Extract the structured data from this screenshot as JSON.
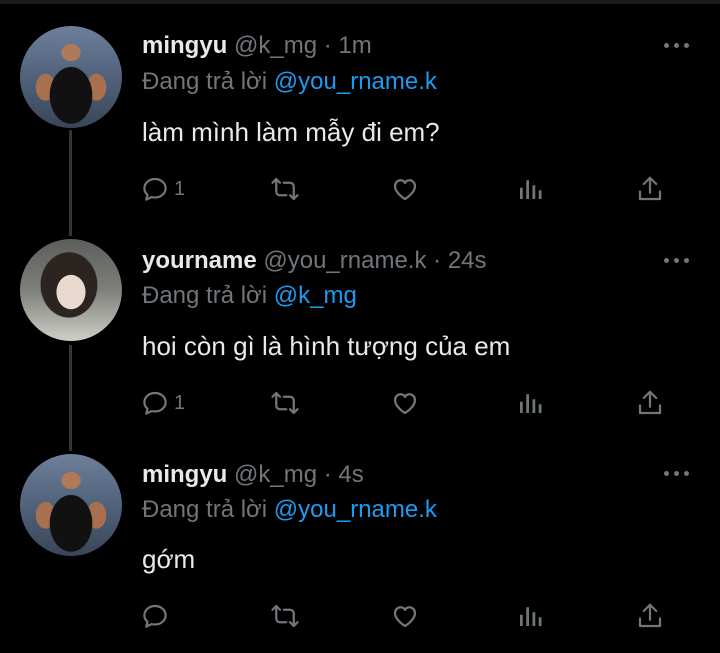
{
  "colors": {
    "background": "#000000",
    "text": "#e7e9ea",
    "muted": "#71767b",
    "link": "#1d9bf0",
    "thread_line": "#333639"
  },
  "tweets": [
    {
      "name": "mingyu",
      "handle": "@k_mg",
      "separator": "·",
      "time": "1m",
      "reply_prefix": "Đang trả lời",
      "reply_to": "@you_rname.k",
      "text": "làm mình làm mẫy đi em?",
      "reply_count": "1",
      "avatar": "mingyu-avatar"
    },
    {
      "name": "yourname",
      "handle": "@you_rname.k",
      "separator": "·",
      "time": "24s",
      "reply_prefix": "Đang trả lời",
      "reply_to": "@k_mg",
      "text": "hoi còn gì là hình tượng của em",
      "reply_count": "1",
      "avatar": "yourname-avatar"
    },
    {
      "name": "mingyu",
      "handle": "@k_mg",
      "separator": "·",
      "time": "4s",
      "reply_prefix": "Đang trả lời",
      "reply_to": "@you_rname.k",
      "text": "gớm",
      "reply_count": "",
      "avatar": "mingyu-avatar"
    }
  ],
  "icons": [
    "more-icon",
    "reply-icon",
    "retweet-icon",
    "like-icon",
    "views-icon",
    "share-icon"
  ]
}
